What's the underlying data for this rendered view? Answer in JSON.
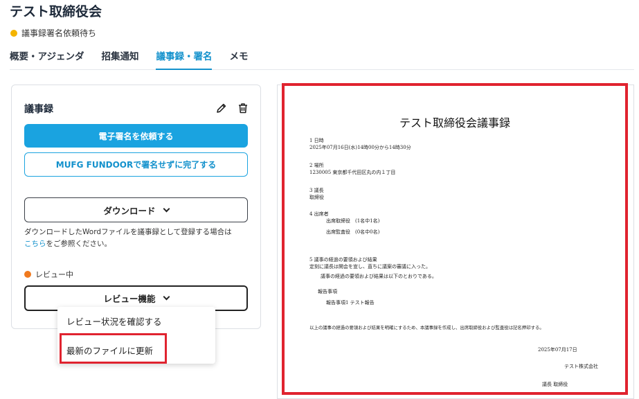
{
  "page": {
    "title": "テスト取締役会",
    "status": "議事録署名依頼待ち"
  },
  "tabs": [
    {
      "label": "概要・アジェンダ"
    },
    {
      "label": "招集通知"
    },
    {
      "label": "議事録・署名",
      "active": true
    },
    {
      "label": "メモ"
    }
  ],
  "minutes": {
    "title": "議事録",
    "edit_icon": "pencil-icon",
    "delete_icon": "trash-icon",
    "request_signature": "電子署名を依頼する",
    "complete_without_signature": "MUFG FUNDOORで署名せずに完了する",
    "download": "ダウンロード",
    "note_prefix": "ダウンロードしたWordファイルを議事録として登録する場合は",
    "note_link": "こちら",
    "note_suffix": "をご参照ください。",
    "review_status": "レビュー中",
    "review_menu": "レビュー機能",
    "dropdown": {
      "check_status": "レビュー状況を確認する",
      "update_file": "最新のファイルに更新"
    }
  },
  "colors": {
    "accent": "#1aa3e0",
    "status_pending": "#f4b400",
    "status_review": "#f07a1f",
    "highlight": "#e0232f"
  },
  "document": {
    "title": "テスト取締役会議事録",
    "lines": [
      "1 日時",
      "2025年07月16日(水)14時00分から14時30分",
      "2 場所",
      "1230005 東京都千代田区丸の内１丁目",
      "3 議長",
      "取締役",
      "4 出席者",
      "出席取締役　(1名中1名)",
      "出席監査役　(0名中0名)",
      "5 議事の経過の要領および結果",
      "定刻に議長は開会を宣し、直ちに議案の審議に入った。",
      "議事の経過の要領および結果は以下のとおりである。",
      "報告事項",
      "報告事項1 テスト報告",
      "以上の議事の経過の要領および結果を明確にするため、本議事録を作成し、出席取締役および監査役は記名押印する。",
      "2025年07月17日",
      "テスト株式会社",
      "議長 取締役"
    ]
  }
}
